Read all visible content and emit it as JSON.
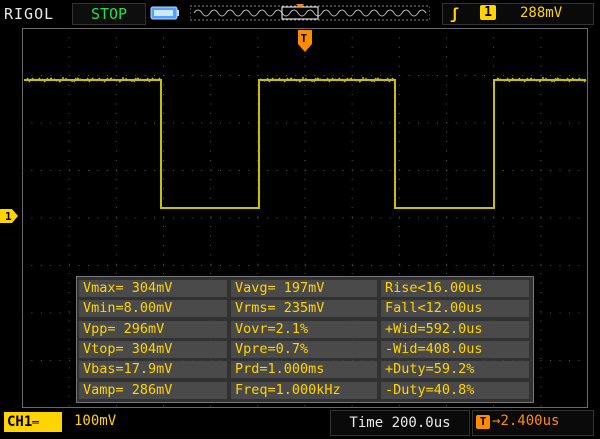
{
  "header": {
    "brand": "RIGOL",
    "run_status": "STOP",
    "trigger_source": "1",
    "trigger_level": "288mV"
  },
  "channel": {
    "marker": "1",
    "label": "CH1",
    "scale": "100mV"
  },
  "timebase": {
    "label": "Time 200.0us",
    "offset": "2.400us",
    "offset_icon": "T"
  },
  "measurements": [
    [
      "Vmax= 304mV",
      "Vavg= 197mV",
      "Rise<16.00us"
    ],
    [
      "Vmin=8.00mV",
      "Vrms= 235mV",
      "Fall<12.00us"
    ],
    [
      "Vpp= 296mV",
      "Vovr=2.1%",
      "+Wid=592.0us"
    ],
    [
      "Vtop= 304mV",
      "Vpre=0.7%",
      "-Wid=408.0us"
    ],
    [
      "Vbas=17.9mV",
      "Prd=1.000ms",
      "+Duty=59.2%"
    ],
    [
      "Vamp= 286mV",
      "Freq=1.000kHz",
      "-Duty=40.8%"
    ]
  ],
  "colors": {
    "trace": "#c8c000",
    "accent": "#ffd400",
    "trigger_marker": "#ff8c00",
    "status": "#22e04a",
    "grid": "#5a5a5a"
  },
  "icons": {
    "trigger_edge": "rising-edge-icon",
    "memory": "battery-memory-icon",
    "trigger_marker": "trigger-position-icon"
  }
}
